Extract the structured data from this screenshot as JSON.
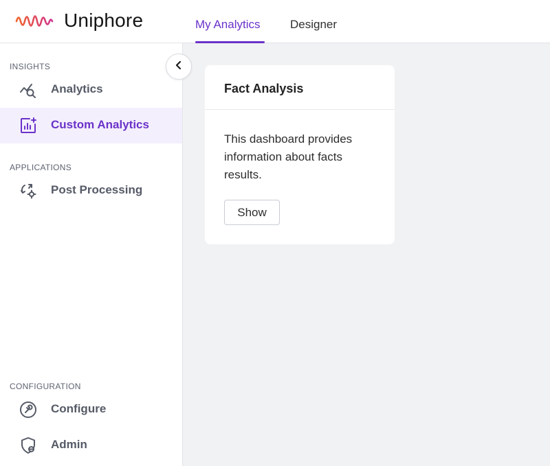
{
  "header": {
    "logo_text": "Uniphore",
    "tabs": [
      {
        "label": "My Analytics",
        "active": true
      },
      {
        "label": "Designer",
        "active": false
      }
    ]
  },
  "sidebar": {
    "sections": {
      "insights": "INSIGHTS",
      "applications": "APPLICATIONS",
      "configuration": "CONFIGURATION"
    },
    "items": [
      {
        "label": "Analytics",
        "icon": "analytics-search-icon",
        "active": false
      },
      {
        "label": "Custom Analytics",
        "icon": "custom-chart-icon",
        "active": true
      },
      {
        "label": "Post Processing",
        "icon": "post-processing-icon",
        "active": false
      },
      {
        "label": "Configure",
        "icon": "wrench-icon",
        "active": false
      },
      {
        "label": "Admin",
        "icon": "admin-shield-icon",
        "active": false
      }
    ],
    "collapse_icon": "chevron-left-icon"
  },
  "card": {
    "title": "Fact Analysis",
    "description": "This dashboard provides information about facts results.",
    "button_label": "Show"
  },
  "colors": {
    "accent": "#6a32c9",
    "active_bg": "#f4effd",
    "logo_gradient_start": "#f0642a",
    "logo_gradient_end": "#d0338f"
  }
}
